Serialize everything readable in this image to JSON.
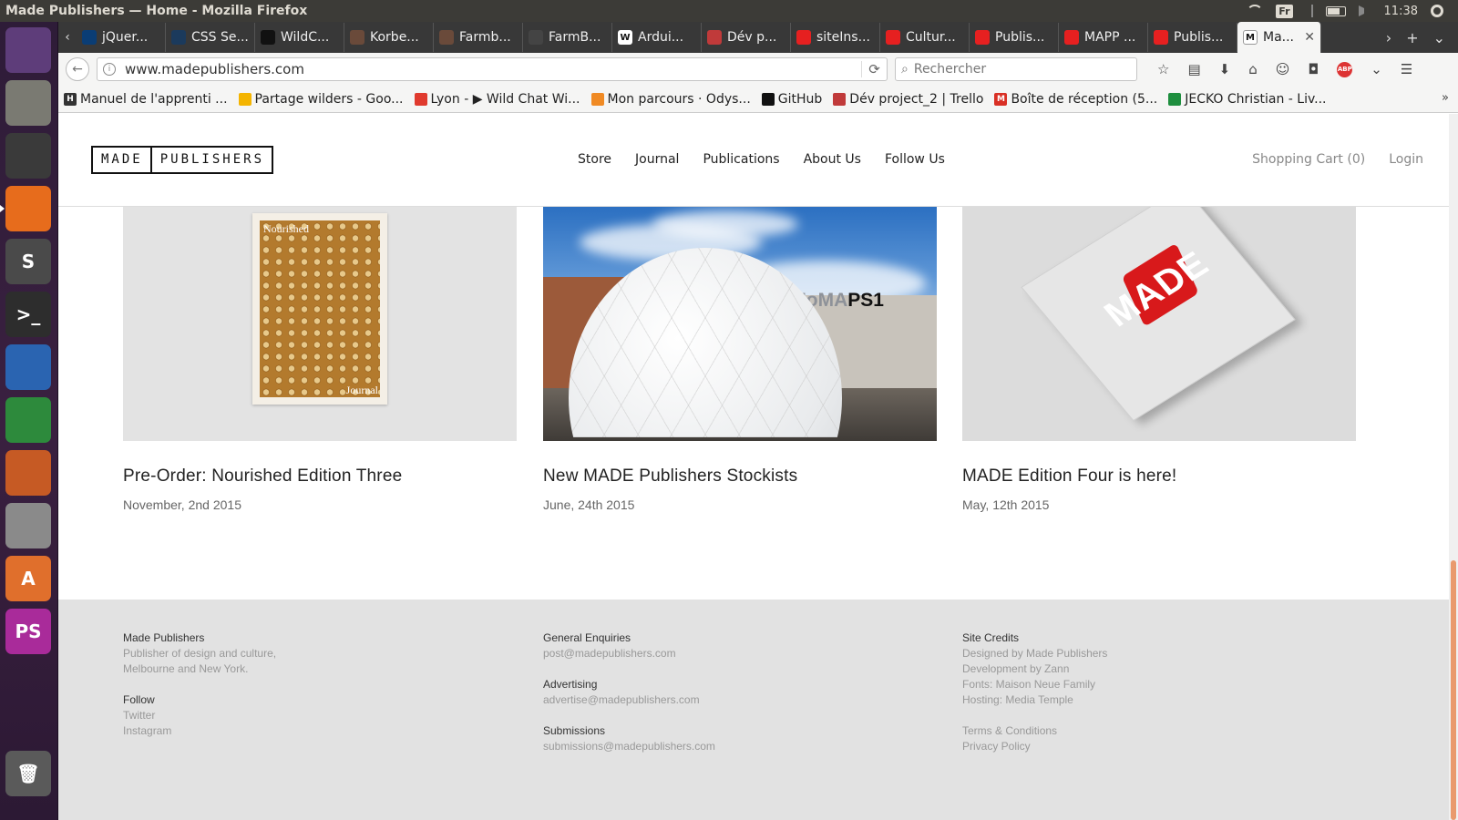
{
  "os": {
    "window_title": "Made Publishers — Home - Mozilla Firefox",
    "keyboard": "Fr",
    "clock": "11:38"
  },
  "launcher": {
    "items": [
      {
        "name": "ubuntu-dash-icon",
        "label": "",
        "bg": "#5e3d7a"
      },
      {
        "name": "files-icon",
        "label": "",
        "bg": "#7a7a72"
      },
      {
        "name": "chrome-icon",
        "label": "",
        "bg": "#3a3a3a"
      },
      {
        "name": "firefox-icon",
        "label": "",
        "bg": "#e76c1c"
      },
      {
        "name": "sublime-text-icon",
        "label": "S",
        "bg": "#4a4a4a"
      },
      {
        "name": "terminal-icon",
        "label": ">_",
        "bg": "#2d2d2d"
      },
      {
        "name": "writer-icon",
        "label": "",
        "bg": "#2a64b1"
      },
      {
        "name": "calc-icon",
        "label": "",
        "bg": "#2d8a3c"
      },
      {
        "name": "impress-icon",
        "label": "",
        "bg": "#c65a24"
      },
      {
        "name": "system-settings-icon",
        "label": "",
        "bg": "#8a8a8a"
      },
      {
        "name": "software-center-icon",
        "label": "A",
        "bg": "#e06f2c"
      },
      {
        "name": "phpstorm-icon",
        "label": "PS",
        "bg": "#a92b9a"
      }
    ],
    "trash": {
      "name": "trash-icon"
    }
  },
  "tabs": [
    {
      "label": "jQuer...",
      "fav_color": "#0a3d75",
      "fav_text": ""
    },
    {
      "label": "CSS Se...",
      "fav_color": "#1b3a5c",
      "fav_text": ""
    },
    {
      "label": "WildC...",
      "fav_color": "#111111",
      "fav_text": ""
    },
    {
      "label": "Korbe...",
      "fav_color": "#6a4a3a",
      "fav_text": ""
    },
    {
      "label": "Farmb...",
      "fav_color": "#6a4a3a",
      "fav_text": ""
    },
    {
      "label": "FarmB...",
      "fav_color": "#444444",
      "fav_text": ""
    },
    {
      "label": "Ardui...",
      "fav_color": "#ffffff",
      "fav_text": "W"
    },
    {
      "label": "Dév p...",
      "fav_color": "#c03a3a",
      "fav_text": ""
    },
    {
      "label": "siteIns...",
      "fav_color": "#e62020",
      "fav_text": ""
    },
    {
      "label": "Cultur...",
      "fav_color": "#e62020",
      "fav_text": ""
    },
    {
      "label": "Publis...",
      "fav_color": "#e62020",
      "fav_text": ""
    },
    {
      "label": "MAPP ...",
      "fav_color": "#e62020",
      "fav_text": ""
    },
    {
      "label": "Publis...",
      "fav_color": "#e62020",
      "fav_text": ""
    }
  ],
  "active_tab": {
    "label": "Ma...",
    "fav_text": "M"
  },
  "url": "www.madepublishers.com",
  "search_placeholder": "Rechercher",
  "bookmarks": [
    {
      "label": "Manuel de l'apprenti ...",
      "fav_color": "#333",
      "fav_text": "H"
    },
    {
      "label": "Partage wilders - Goo...",
      "fav_color": "#f4b400",
      "fav_text": ""
    },
    {
      "label": "Lyon - ▶ Wild Chat Wi...",
      "fav_color": "#e03a2e",
      "fav_text": ""
    },
    {
      "label": "Mon parcours · Odys...",
      "fav_color": "#f08a24",
      "fav_text": ""
    },
    {
      "label": "GitHub",
      "fav_color": "#111",
      "fav_text": ""
    },
    {
      "label": "Dév project_2 | Trello",
      "fav_color": "#c03a3a",
      "fav_text": ""
    },
    {
      "label": "Boîte de réception (5...",
      "fav_color": "#d93025",
      "fav_text": "M"
    },
    {
      "label": "JECKO Christian - Liv...",
      "fav_color": "#1e8e3e",
      "fav_text": ""
    }
  ],
  "site": {
    "logo": [
      "MADE",
      "PUBLISHERS"
    ],
    "nav": [
      "Store",
      "Journal",
      "Publications",
      "About Us",
      "Follow Us"
    ],
    "cart": "Shopping Cart (0)",
    "login": "Login"
  },
  "posts": [
    {
      "title": "Pre-Order: Nourished Edition Three",
      "date": "November, 2nd 2015",
      "cover_title": "Nourished",
      "cover_footer": "Journal"
    },
    {
      "title": "New MADE Publishers Stockists",
      "date": "June, 24th 2015",
      "sign_a": "MoMA",
      "sign_b": "PS1"
    },
    {
      "title": "MADE Edition Four is here!",
      "date": "May, 12th 2015",
      "cover_word": "MADE"
    }
  ],
  "footer": {
    "col1": {
      "heading": "Made Publishers",
      "lines": [
        "Publisher of design and culture,",
        "Melbourne and New York."
      ],
      "follow_heading": "Follow",
      "follow_links": [
        "Twitter",
        "Instagram"
      ]
    },
    "col2": {
      "general_heading": "General Enquiries",
      "general_email": "post@madepublishers.com",
      "adv_heading": "Advertising",
      "adv_email": "advertise@madepublishers.com",
      "sub_heading": "Submissions",
      "sub_email": "submissions@madepublishers.com"
    },
    "col3": {
      "heading": "Site Credits",
      "lines": [
        "Designed by Made Publishers",
        "Development by Zann",
        "Fonts: Maison Neue Family",
        "Hosting: Media Temple"
      ],
      "legal": [
        "Terms & Conditions",
        "Privacy Policy"
      ]
    }
  }
}
